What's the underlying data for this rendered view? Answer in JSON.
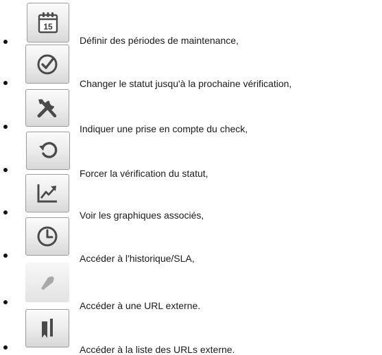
{
  "items": [
    {
      "icon": "calendar-icon",
      "day": "15",
      "label": "Définir des périodes de maintenance,"
    },
    {
      "icon": "check-circle-icon",
      "label": "Changer le statut jusqu'à la prochaine vérification,"
    },
    {
      "icon": "tools-icon",
      "label": "Indiquer une prise en compte du check,"
    },
    {
      "icon": "refresh-icon",
      "label": "Forcer la vérification du statut,"
    },
    {
      "icon": "chart-icon",
      "label": "Voir les graphiques associés,"
    },
    {
      "icon": "clock-icon",
      "label": "Accéder à l'historique/SLA,"
    },
    {
      "icon": "pin-icon",
      "label": "Accéder à une URL externe."
    },
    {
      "icon": "bookmark-icon",
      "label": "Accéder à la liste des URLs externe."
    }
  ]
}
